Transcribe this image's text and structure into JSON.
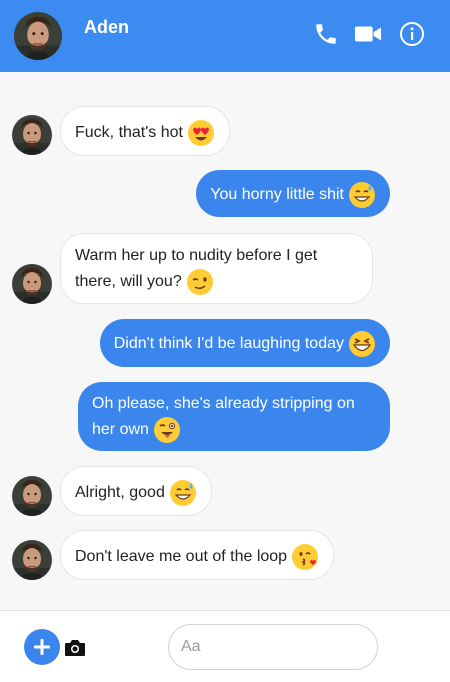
{
  "header": {
    "contact_name": "Aden",
    "icons": [
      "phone-icon",
      "video-camera-icon",
      "info-icon"
    ],
    "background_color": "#3b8bf0"
  },
  "messages": [
    {
      "direction": "incoming",
      "text": "Fuck, that's hot",
      "emoji": "heart-eyes-emoji"
    },
    {
      "direction": "outgoing",
      "text": "You horny little shit",
      "emoji": "grinning-sweat-emoji"
    },
    {
      "direction": "incoming",
      "text": "Warm her up to nudity before I get there, will you?",
      "emoji": "winking-emoji"
    },
    {
      "direction": "outgoing",
      "text": "Didn't think I'd be laughing today",
      "emoji": "grinning-squint-emoji"
    },
    {
      "direction": "outgoing",
      "text": "Oh please, she's already stripping on her own",
      "emoji": "winking-tongue-emoji"
    },
    {
      "direction": "incoming",
      "text": "Alright, good",
      "emoji": "grinning-sweat-emoji"
    },
    {
      "direction": "incoming",
      "text": "Don't leave me out of the loop",
      "emoji": "kissing-wink-emoji"
    }
  ],
  "composer": {
    "placeholder": "Aa",
    "icons": [
      "plus-icon",
      "camera-icon"
    ]
  },
  "colors": {
    "outgoing_bubble": "#3b86ec",
    "incoming_bubble": "#ffffff",
    "chat_background": "#f7f7f8"
  }
}
